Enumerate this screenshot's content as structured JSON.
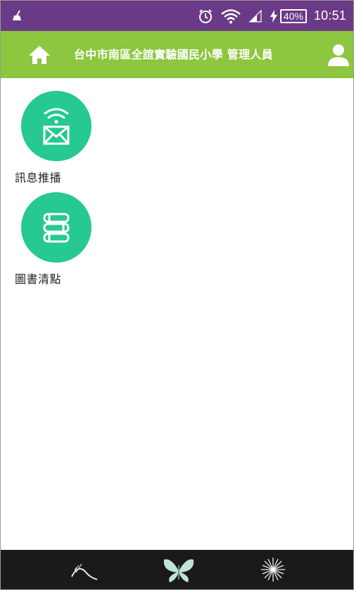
{
  "status_bar": {
    "battery_percent": "40%",
    "time": "10:51",
    "background": "#6a3a86"
  },
  "app_bar": {
    "title": "台中市南區全誼實驗國民小學 管理人員",
    "background": "#8dc63f"
  },
  "features": [
    {
      "label": "訊息推播",
      "icon": "wifi-mail-icon"
    },
    {
      "label": "圖書清點",
      "icon": "book-stack-icon"
    }
  ],
  "accent_color": "#26c98f",
  "bottom_nav": {
    "background": "#1a1a1a",
    "items": [
      {
        "icon": "dandelion-seed-icon"
      },
      {
        "icon": "butterfly-icon"
      },
      {
        "icon": "dandelion-icon"
      }
    ]
  }
}
